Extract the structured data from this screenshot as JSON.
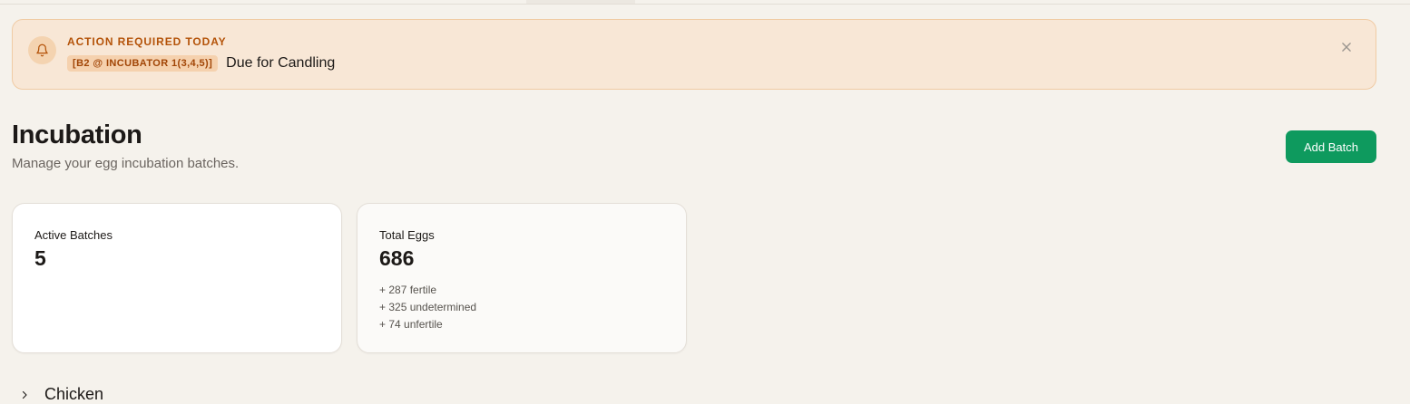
{
  "alert": {
    "title": "ACTION REQUIRED TODAY",
    "tag": "[B2 @ INCUBATOR 1(3,4,5)]",
    "message": "Due for Candling",
    "icon": "bell-icon",
    "close_icon": "close-icon"
  },
  "header": {
    "title": "Incubation",
    "subtitle": "Manage your egg incubation batches.",
    "add_button_label": "Add Batch"
  },
  "stats": [
    {
      "label": "Active Batches",
      "value": "5",
      "details": []
    },
    {
      "label": "Total Eggs",
      "value": "686",
      "details": [
        "+ 287 fertile",
        "+ 325 undetermined",
        "+ 74 unfertile"
      ]
    }
  ],
  "sections": [
    {
      "label": "Chicken",
      "icon": "chevron-right-icon"
    }
  ],
  "colors": {
    "alert_bg": "#f8e7d6",
    "alert_accent": "#b45309",
    "primary_button": "#0e9a5e",
    "page_bg": "#f5f2ec"
  }
}
